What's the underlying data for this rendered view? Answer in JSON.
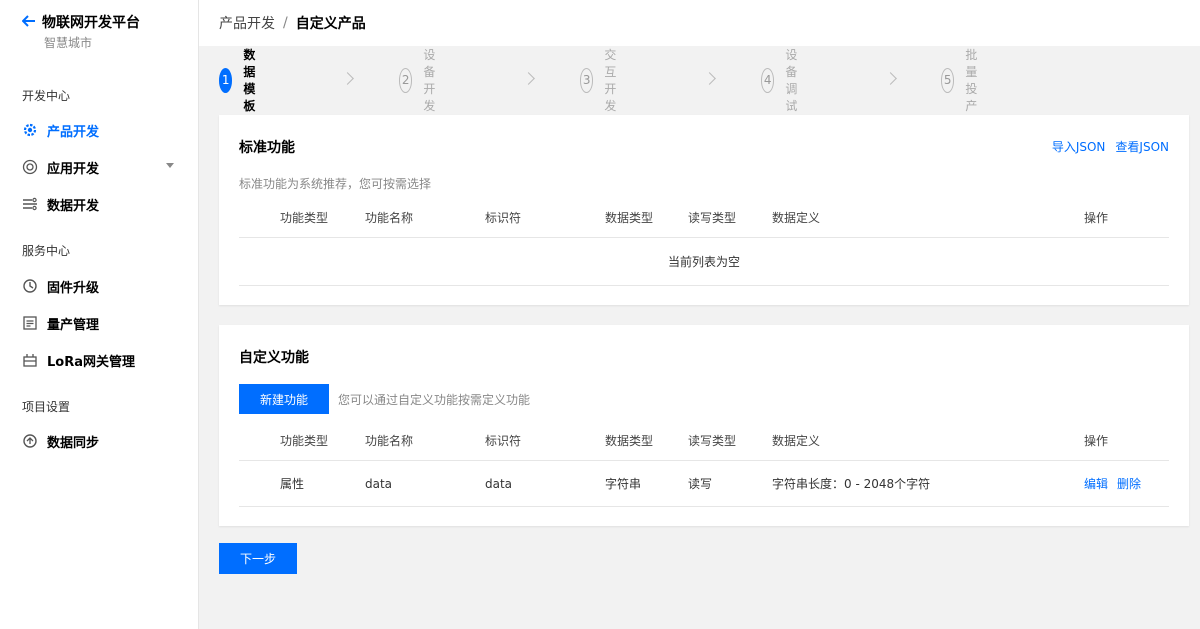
{
  "brand": {
    "back_icon": "arrow-left-icon",
    "title": "物联网开发平台",
    "subtitle": "智慧城市"
  },
  "sidebar": {
    "groups": [
      {
        "label": "开发中心"
      },
      {
        "label": "服务中心"
      },
      {
        "label": "项目设置"
      }
    ],
    "items": [
      {
        "label": "产品开发",
        "icon": "gear-icon",
        "active": true
      },
      {
        "label": "应用开发",
        "icon": "app-icon",
        "active": false,
        "expandable": true
      },
      {
        "label": "数据开发",
        "icon": "data-flow-icon",
        "active": false
      },
      {
        "label": "固件升级",
        "icon": "firmware-icon",
        "active": false
      },
      {
        "label": "量产管理",
        "icon": "list-icon",
        "active": false
      },
      {
        "label": "LoRa网关管理",
        "icon": "gateway-icon",
        "active": false
      },
      {
        "label": "数据同步",
        "icon": "sync-icon",
        "active": false
      }
    ]
  },
  "breadcrumb": {
    "parent": "产品开发",
    "separator": "/",
    "current": "自定义产品"
  },
  "steps": [
    {
      "num": "1",
      "label": "数据模板",
      "active": true
    },
    {
      "num": "2",
      "label": "设备开发",
      "active": false
    },
    {
      "num": "3",
      "label": "交互开发",
      "active": false
    },
    {
      "num": "4",
      "label": "设备调试",
      "active": false
    },
    {
      "num": "5",
      "label": "批量投产",
      "active": false
    }
  ],
  "standard": {
    "title": "标准功能",
    "desc": "标准功能为系统推荐，您可按需选择",
    "import_json": "导入JSON",
    "view_json": "查看JSON",
    "empty_text": "当前列表为空"
  },
  "columns": [
    "功能类型",
    "功能名称",
    "标识符",
    "数据类型",
    "读写类型",
    "数据定义",
    "操作"
  ],
  "custom": {
    "title": "自定义功能",
    "new_button": "新建功能",
    "hint": "您可以通过自定义功能按需定义功能",
    "rows": [
      {
        "type": "属性",
        "name": "data",
        "identifier": "data",
        "data_type": "字符串",
        "rw": "读写",
        "definition": "字符串长度：0 - 2048个字符",
        "edit": "编辑",
        "delete": "删除"
      }
    ]
  },
  "next_button": "下一步",
  "colors": {
    "accent": "#006eff",
    "background": "#f2f2f2"
  }
}
